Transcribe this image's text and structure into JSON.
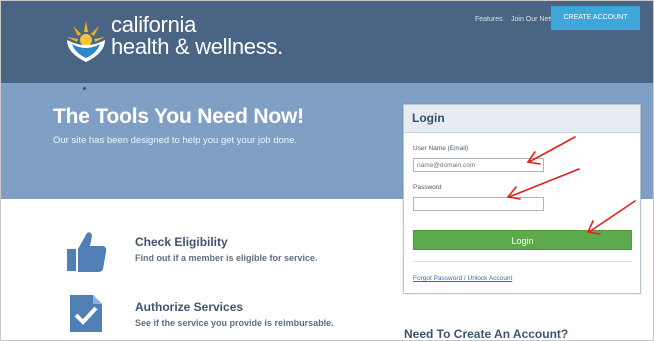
{
  "header": {
    "logo_line1": "california",
    "logo_line2": "health & wellness.",
    "nav_features": "Features",
    "nav_join": "Join Our Network",
    "create_account": "CREATE ACCOUNT"
  },
  "hero": {
    "title": "The Tools You Need Now!",
    "subtitle": "Our site has been designed to help you get your job done."
  },
  "features": [
    {
      "title": "Check Eligibility",
      "description": "Find out if a member is eligible for service."
    },
    {
      "title": "Authorize Services",
      "description": "See if the service you provide is reimbursable."
    }
  ],
  "login": {
    "title": "Login",
    "username_label": "User Name (Email)",
    "username_placeholder": "name@domain.com",
    "password_label": "Password",
    "password_value": "",
    "button_label": "Login",
    "forgot_link": "Forgot Password / Unlock Account"
  },
  "create_account_heading": "Need To Create An Account?",
  "colors": {
    "header_bg": "#4a6584",
    "hero_bg": "#7fa0c4",
    "accent_blue": "#3fa7d8",
    "login_green": "#5daa4a",
    "annotation_red": "#e02020"
  },
  "icons": [
    "sun-logo-icon",
    "thumbs-up-icon",
    "checklist-icon"
  ]
}
